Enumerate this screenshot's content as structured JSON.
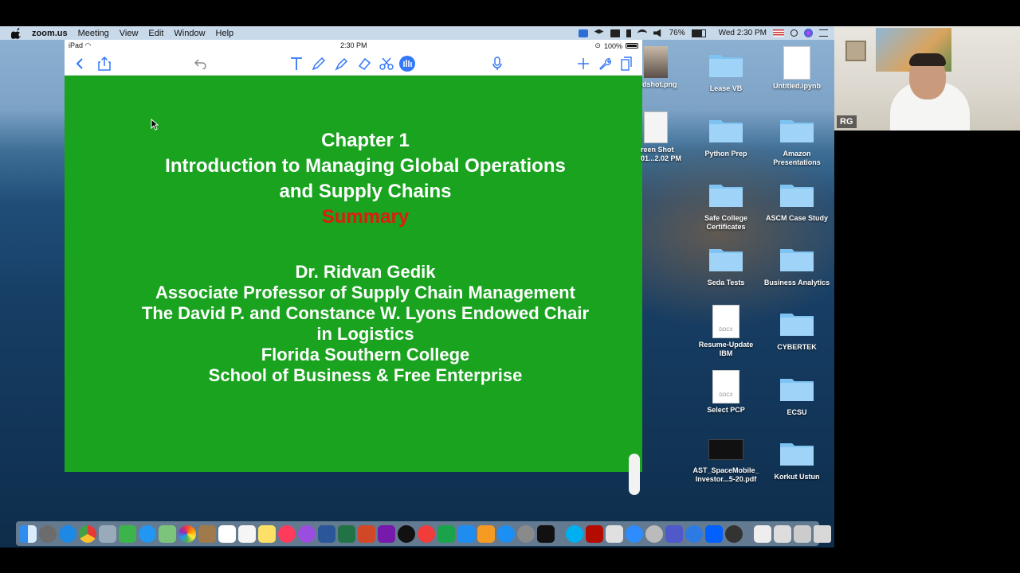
{
  "menubar": {
    "app": "zoom.us",
    "items": [
      "Meeting",
      "View",
      "Edit",
      "Window",
      "Help"
    ],
    "battery": "76%",
    "clock": "Wed 2:30 PM"
  },
  "ipad": {
    "device": "iPad",
    "time": "2:30 PM",
    "battery": "100%"
  },
  "slide": {
    "title_lines": [
      "Chapter 1",
      "Introduction to Managing Global Operations",
      "and Supply Chains"
    ],
    "summary": "Summary",
    "author_lines": [
      "Dr. Ridvan Gedik",
      "Associate Professor of Supply Chain Management",
      "The David P. and Constance W. Lyons Endowed Chair",
      "in Logistics",
      "Florida Southern College",
      "School of Business & Free Enterprise"
    ],
    "colors": {
      "background": "#19a31f",
      "text": "#ffffff",
      "summary": "#e01b0f"
    }
  },
  "desktop": {
    "icons": [
      {
        "label": "dshot.png"
      },
      {
        "label": "Lease VB"
      },
      {
        "label": "Untitled.ipynb"
      },
      {
        "label": "reen Shot\n01...2.02 PM"
      },
      {
        "label": "Python Prep"
      },
      {
        "label": "Amazon\nPresentations"
      },
      {
        "label": "Safe College\nCertificates"
      },
      {
        "label": "ASCM Case Study"
      },
      {
        "label": "Seda Tests"
      },
      {
        "label": "Business Analytics"
      },
      {
        "label": "Resume-Update\nIBM"
      },
      {
        "label": "CYBERTEK"
      },
      {
        "label": "Select PCP"
      },
      {
        "label": "ECSU"
      },
      {
        "label": "AST_SpaceMobile_\nInvestor...5-20.pdf"
      },
      {
        "label": "Korkut Ustun"
      }
    ]
  },
  "video": {
    "initials": "RG"
  }
}
